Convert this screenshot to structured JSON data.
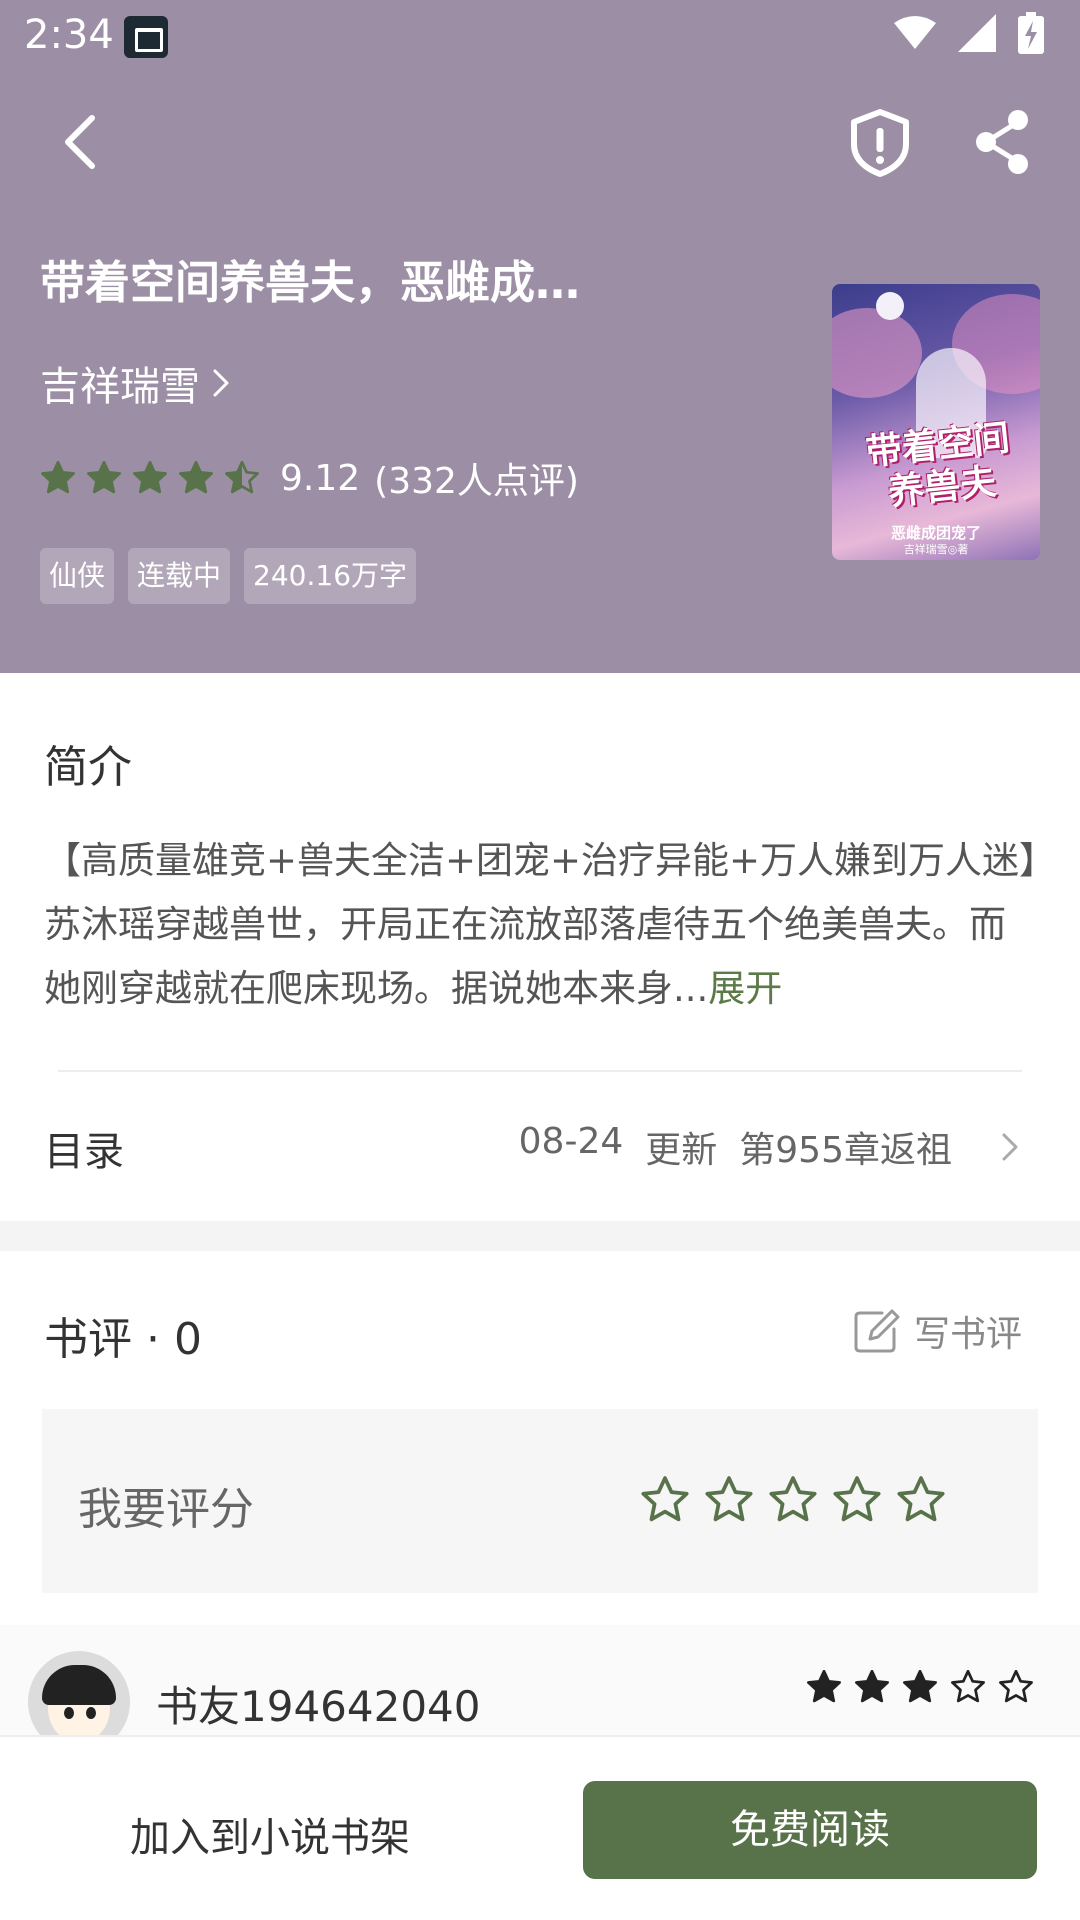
{
  "status_bar": {
    "time": "2:34"
  },
  "book": {
    "title": "带着空间养兽夫，恶雌成…",
    "author": "吉祥瑞雪",
    "rating_score": "9.12",
    "rating_count": "(332人点评)",
    "rating_value": 4.5,
    "rating_max": 5,
    "tags": [
      "仙侠",
      "连载中",
      "240.16万字"
    ],
    "cover": {
      "title": "带着空间养兽夫",
      "subtitle": "恶雌成团宠了",
      "author": "吉祥瑞雪◎著"
    }
  },
  "intro": {
    "heading": "简介",
    "text": "【高质量雄竞+兽夫全洁+团宠+治疗异能+万人嫌到万人迷】苏沐瑶穿越兽世，开局正在流放部落虐待五个绝美兽夫。而她刚穿越就在爬床现场。据说她本来身...",
    "expand": "展开"
  },
  "toc": {
    "label": "目录",
    "date": "08-24",
    "update": "更新",
    "latest_chapter": "第955章返祖"
  },
  "reviews": {
    "heading": "书评 · 0",
    "write_label": "写书评",
    "rate_prompt": "我要评分",
    "rate_value": 0,
    "rate_max": 5
  },
  "comment": {
    "user": "书友194642040",
    "stars": 3,
    "stars_max": 5
  },
  "bottom": {
    "shelf_label": "加入到小说书架",
    "read_label": "免费阅读"
  },
  "colors": {
    "header_bg": "#9c8fa5",
    "accent_green": "#587349",
    "expand_green": "#5b7a47"
  }
}
